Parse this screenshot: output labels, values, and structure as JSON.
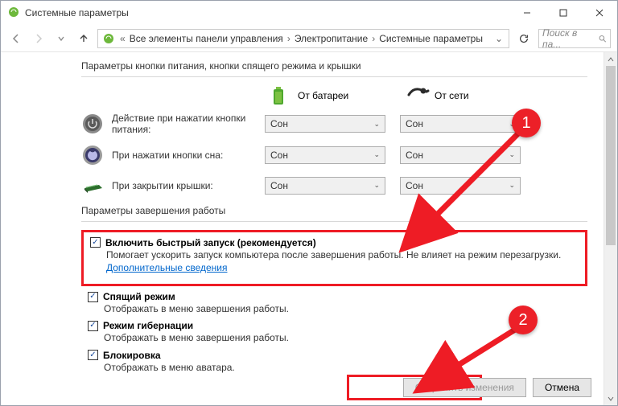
{
  "window": {
    "title": "Системные параметры"
  },
  "breadcrumb": {
    "item1": "Все элементы панели управления",
    "item2": "Электропитание",
    "item3": "Системные параметры"
  },
  "search": {
    "placeholder": "Поиск в па..."
  },
  "section1": {
    "title": "Параметры кнопки питания, кнопки спящего режима и крышки",
    "col_battery": "От батареи",
    "col_ac": "От сети",
    "row1": {
      "label": "Действие при нажатии кнопки питания:",
      "battery": "Сон",
      "ac": "Сон"
    },
    "row2": {
      "label": "При нажатии кнопки сна:",
      "battery": "Сон",
      "ac": "Сон"
    },
    "row3": {
      "label": "При закрытии крышки:",
      "battery": "Сон",
      "ac": "Сон"
    }
  },
  "section2": {
    "title": "Параметры завершения работы",
    "fast": {
      "label": "Включить быстрый запуск (рекомендуется)",
      "desc": "Помогает ускорить запуск компьютера после завершения работы. Не влияет на режим перезагрузки. ",
      "link": "Дополнительные сведения"
    },
    "sleep": {
      "label": "Спящий режим",
      "desc": "Отображать в меню завершения работы."
    },
    "hibernate": {
      "label": "Режим гибернации",
      "desc": "Отображать в меню завершения работы."
    },
    "lock": {
      "label": "Блокировка",
      "desc": "Отображать в меню аватара."
    }
  },
  "buttons": {
    "save": "Сохранить изменения",
    "cancel": "Отмена"
  },
  "callouts": {
    "c1": "1",
    "c2": "2"
  }
}
